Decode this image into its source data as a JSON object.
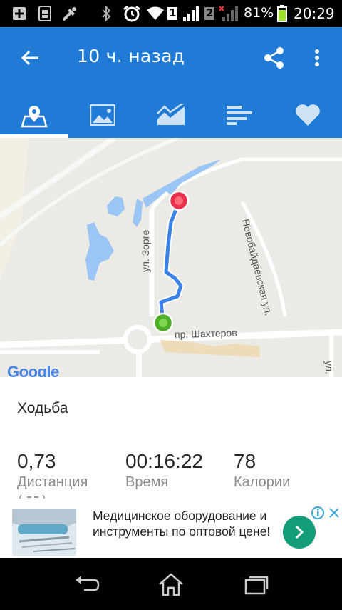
{
  "status_bar": {
    "battery_percent": "81%",
    "time": "20:29",
    "sim1": "1",
    "sim2": "2",
    "icons": [
      "plus-box-icon",
      "sim-manager-icon",
      "tools-icon",
      "bluetooth-icon",
      "alarm-icon",
      "wifi-icon",
      "signal-sim1-icon",
      "signal-sim2-icon",
      "battery-icon"
    ]
  },
  "app_bar": {
    "title": "10 ч. назад",
    "icons": [
      "back-arrow-icon",
      "share-icon",
      "more-vert-icon"
    ]
  },
  "tabs": [
    {
      "name": "map",
      "icon": "map-pin-icon",
      "selected": true
    },
    {
      "name": "photos",
      "icon": "image-icon",
      "selected": false
    },
    {
      "name": "chart",
      "icon": "area-chart-icon",
      "selected": false
    },
    {
      "name": "stats",
      "icon": "bars-icon",
      "selected": false
    },
    {
      "name": "favorite",
      "icon": "heart-icon",
      "selected": false
    }
  ],
  "map": {
    "street_zorge": "ул. Зорге",
    "street_shakhterov": "пр. Шахтеров",
    "street_novobaidaevskaya": "Новобайдаевская ул.",
    "street_edge": "ул.",
    "google_logo": "Google",
    "route_color": "#3b82e8",
    "start_color": "#4caf27",
    "end_color": "#e8314b"
  },
  "activity": {
    "type": "Ходьба",
    "stats": [
      {
        "value": "0,73",
        "label": "Дистанция"
      },
      {
        "value": "00:16:22",
        "label": "Время"
      },
      {
        "value": "78",
        "label": "Калории"
      }
    ]
  },
  "ad": {
    "text": "Медицинское оборудование и инструменты по оптовой цене!",
    "go_color": "#139d78",
    "icons": [
      "adchoices-icon",
      "close-icon",
      "chevron-right-icon"
    ]
  },
  "nav_bar": {
    "icons": [
      "back-icon",
      "home-icon",
      "recents-icon"
    ]
  },
  "colors": {
    "primary": "#1f7bd5",
    "status_bar": "#000000"
  }
}
